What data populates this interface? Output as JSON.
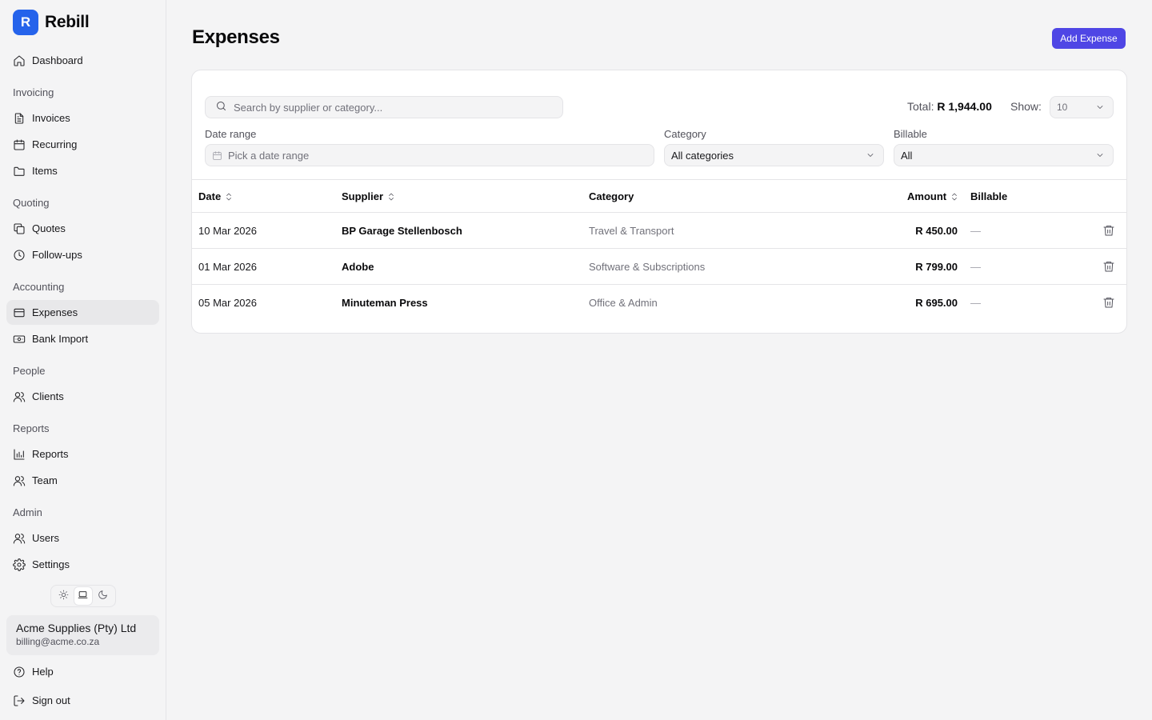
{
  "app": {
    "logo_letter": "R",
    "name": "Rebill"
  },
  "sidebar": {
    "dashboard": {
      "label": "Dashboard",
      "icon": "home-icon"
    },
    "sections": {
      "invoicing": "Invoicing",
      "quoting": "Quoting",
      "accounting": "Accounting",
      "people": "People",
      "reports": "Reports",
      "admin": "Admin"
    },
    "items": {
      "invoices": "Invoices",
      "recurring": "Recurring",
      "items": "Items",
      "quotes": "Quotes",
      "followups": "Follow-ups",
      "expenses": "Expenses",
      "bank_import": "Bank Import",
      "clients": "Clients",
      "reports": "Reports",
      "team": "Team",
      "users": "Users",
      "settings": "Settings"
    },
    "active_item": "Expenses",
    "theme": {
      "options": [
        "light",
        "system",
        "dark"
      ],
      "selected": "system"
    },
    "account": {
      "name": "Acme Supplies (Pty) Ltd",
      "email": "billing@acme.co.za"
    },
    "help": "Help",
    "sign_out": "Sign out"
  },
  "main": {
    "title": "Expenses",
    "add_button": "Add Expense",
    "search": {
      "placeholder": "Search by supplier or category...",
      "value": ""
    },
    "total": {
      "label": "Total:",
      "value": "R 1,944.00"
    },
    "show": {
      "label": "Show:",
      "value": "10"
    },
    "filters": {
      "date_range": {
        "label": "Date range",
        "placeholder": "Pick a date range"
      },
      "category": {
        "label": "Category",
        "value": "All categories"
      },
      "billable": {
        "label": "Billable",
        "value": "All"
      }
    },
    "table": {
      "columns": {
        "date": "Date",
        "supplier": "Supplier",
        "category": "Category",
        "amount": "Amount",
        "billable": "Billable"
      },
      "rows": [
        {
          "date": "10 Mar 2026",
          "supplier": "BP Garage Stellenbosch",
          "category": "Travel & Transport",
          "amount": "R 450.00",
          "billable": "—"
        },
        {
          "date": "01 Mar 2026",
          "supplier": "Adobe",
          "category": "Software & Subscriptions",
          "amount": "R 799.00",
          "billable": "—"
        },
        {
          "date": "05 Mar 2026",
          "supplier": "Minuteman Press",
          "category": "Office & Admin",
          "amount": "R 695.00",
          "billable": "—"
        }
      ]
    }
  },
  "colors": {
    "accent": "#4f46e5",
    "logo": "#2563eb",
    "background": "#f4f4f5",
    "card": "#ffffff",
    "border": "#e4e4e7"
  }
}
